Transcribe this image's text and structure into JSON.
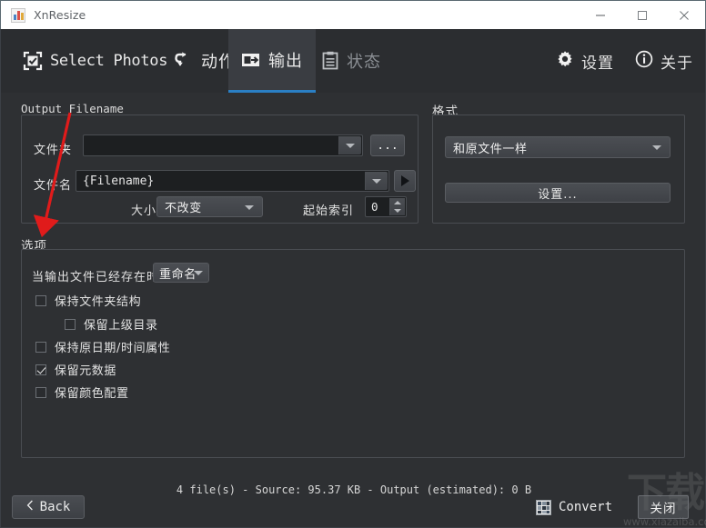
{
  "window": {
    "title": "XnResize",
    "app_icon": "app-chart-icon",
    "controls": {
      "minimize": "minimize-icon",
      "maximize": "maximize-icon",
      "close": "close-icon"
    }
  },
  "tabs": [
    {
      "id": "select-photos",
      "label": "Select Photos",
      "icon": "checkbox-frame-icon",
      "active": false,
      "dim": false,
      "cjk": false
    },
    {
      "id": "actions",
      "label": "动作",
      "icon": "undo-arrow-icon",
      "active": false,
      "dim": false,
      "cjk": true
    },
    {
      "id": "output",
      "label": "输出",
      "icon": "export-arrow-icon",
      "active": true,
      "dim": false,
      "cjk": true
    },
    {
      "id": "status",
      "label": "状态",
      "icon": "clipboard-icon",
      "active": false,
      "dim": true,
      "cjk": true
    }
  ],
  "tab_actions": [
    {
      "id": "settings",
      "label": "设置",
      "icon": "gear-icon"
    },
    {
      "id": "about",
      "label": "关于",
      "icon": "info-circle-icon"
    }
  ],
  "output_filename": {
    "group_title": "Output Filename",
    "folder": {
      "label": "文件夹",
      "value": "",
      "browse_label": "..."
    },
    "filename": {
      "label": "文件名",
      "value": "{Filename}",
      "play_icon": "play-triangle-icon"
    },
    "case": {
      "label": "大小写",
      "value": "不改变"
    },
    "start_index": {
      "label": "起始索引",
      "value": "0"
    }
  },
  "format": {
    "group_title": "格式",
    "type_value": "和原文件一样",
    "settings_label": "设置..."
  },
  "options": {
    "group_title": "选项",
    "exists_label": "当输出文件已经存在时",
    "exists_value": "重命名",
    "checkboxes": [
      {
        "id": "keep-folder-structure",
        "label": "保持文件夹结构",
        "checked": false,
        "indent": 0
      },
      {
        "id": "keep-parent-directory",
        "label": "保留上级目录",
        "checked": false,
        "indent": 1
      },
      {
        "id": "keep-original-datetime",
        "label": "保持原日期/时间属性",
        "checked": false,
        "indent": 0
      },
      {
        "id": "keep-metadata",
        "label": "保留元数据",
        "checked": true,
        "indent": 0
      },
      {
        "id": "keep-color-profile",
        "label": "保留颜色配置",
        "checked": false,
        "indent": 0
      }
    ]
  },
  "bottom": {
    "status": "4 file(s) - Source: 95.37 KB - Output (estimated): 0 B",
    "back_label": "Back",
    "back_icon": "chevron-left-icon",
    "convert_label": "Convert",
    "convert_icon": "convert-image-icon",
    "close_label": "关闭"
  },
  "watermark": {
    "text": "下载吧",
    "url": "www.xiazaiba.com"
  },
  "annotation": {
    "arrow_color": "#e01b1b"
  },
  "colors": {
    "window_bg": "#2e3033",
    "tabbar_bg": "#2b2d30",
    "active_tab_bg": "#3a3d42",
    "accent": "#2a7fc4",
    "titlebar_bg": "#ffffff",
    "field_bg": "#1d1f21"
  }
}
